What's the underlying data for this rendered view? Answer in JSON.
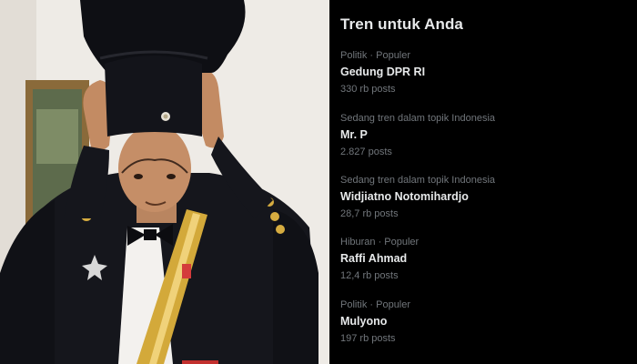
{
  "trends_panel": {
    "title": "Tren untuk Anda",
    "items": [
      {
        "meta": "Politik · Populer",
        "name": "Gedung DPR RI",
        "count": "330 rb posts"
      },
      {
        "meta": "Sedang tren dalam topik Indonesia",
        "name": "Mr. P",
        "count": "2.827 posts"
      },
      {
        "meta": "Sedang tren dalam topik Indonesia",
        "name": "Widjiatno Notomihardjo",
        "count": "28,7 rb posts"
      },
      {
        "meta": "Hiburan · Populer",
        "name": "Raffi Ahmad",
        "count": "12,4 rb posts"
      },
      {
        "meta": "Politik · Populer",
        "name": "Mulyono",
        "count": "197 rb posts"
      }
    ]
  },
  "colors": {
    "panel_background": "#000000",
    "primary_text": "#e7e9ea",
    "secondary_text": "#71767b"
  }
}
